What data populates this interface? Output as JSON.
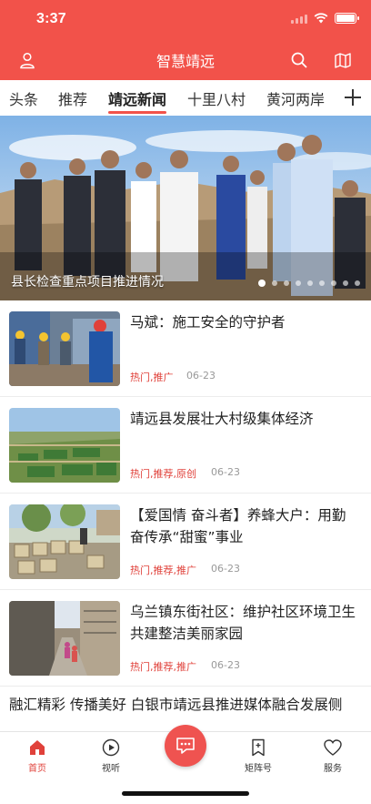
{
  "status_bar": {
    "time": "3:37"
  },
  "header": {
    "title": "智慧靖远",
    "user_icon": "user-icon",
    "search_icon": "search-icon",
    "map_icon": "map-icon",
    "accent": "#f2524a"
  },
  "tabs": [
    {
      "label": "头条"
    },
    {
      "label": "推荐"
    },
    {
      "label": "靖远新闻",
      "active": true
    },
    {
      "label": "十里八村"
    },
    {
      "label": "黄河两岸"
    }
  ],
  "hero": {
    "caption": "县长检查重点项目推进情况",
    "slide_count": 9,
    "active_slide": 1
  },
  "news": [
    {
      "title": "马斌：施工安全的守护者",
      "tags": "热门,推广",
      "date": "06-23"
    },
    {
      "title": "靖远县发展壮大村级集体经济",
      "tags": "热门,推荐,原创",
      "date": "06-23"
    },
    {
      "title": "【爱国情 奋斗者】养蜂大户：用勤奋传承“甜蜜”事业",
      "tags": "热门,推荐,推广",
      "date": "06-23"
    },
    {
      "title": "乌兰镇东街社区：维护社区环境卫生 共建整洁美丽家园",
      "tags": "热门,推荐,推广",
      "date": "06-23"
    },
    {
      "title": "融汇精彩 传播美好 白银市靖远县推进媒体融合发展侧"
    }
  ],
  "bottom_nav": {
    "items": [
      {
        "label": "首页",
        "icon": "home-icon",
        "active": true
      },
      {
        "label": "视听",
        "icon": "play-icon"
      },
      {
        "label": "",
        "icon": "chat-icon"
      },
      {
        "label": "矩阵号",
        "icon": "bookmark-icon"
      },
      {
        "label": "服务",
        "icon": "heart-icon"
      }
    ]
  }
}
